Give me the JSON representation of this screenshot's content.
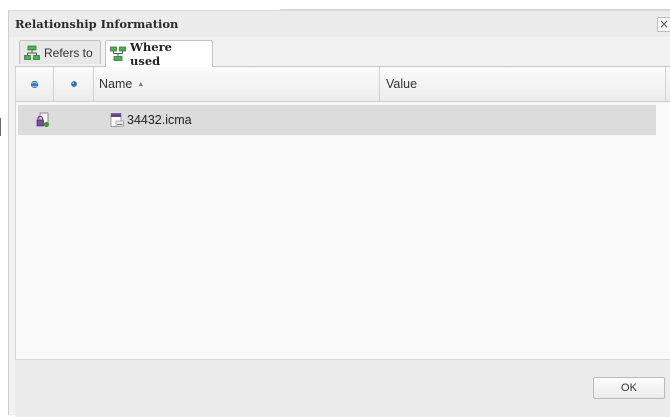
{
  "dialog": {
    "title": "Relationship Information",
    "close_glyph": "×",
    "ok_label": "OK"
  },
  "tabs": [
    {
      "label": "Refers to",
      "icon": "refers-to-tree-icon",
      "active": false
    },
    {
      "label": "Where used",
      "icon": "where-used-tree-icon",
      "active": true
    }
  ],
  "grid": {
    "columns": [
      {
        "label": "",
        "icon": "status-globe-icon"
      },
      {
        "label": "",
        "icon": "status-dot-icon"
      },
      {
        "label": "Name",
        "sort": "ascending"
      },
      {
        "label": "Value"
      }
    ],
    "rows": [
      {
        "status_icon": "locked-document-icon",
        "file_icon": "icma-file-icon",
        "name": "34432.icma",
        "value": ""
      }
    ]
  },
  "colors": {
    "accent_icon_green": "#3a9a3a",
    "header_dot": "#2f6fb4",
    "row_selected": "#dcdcdc"
  }
}
